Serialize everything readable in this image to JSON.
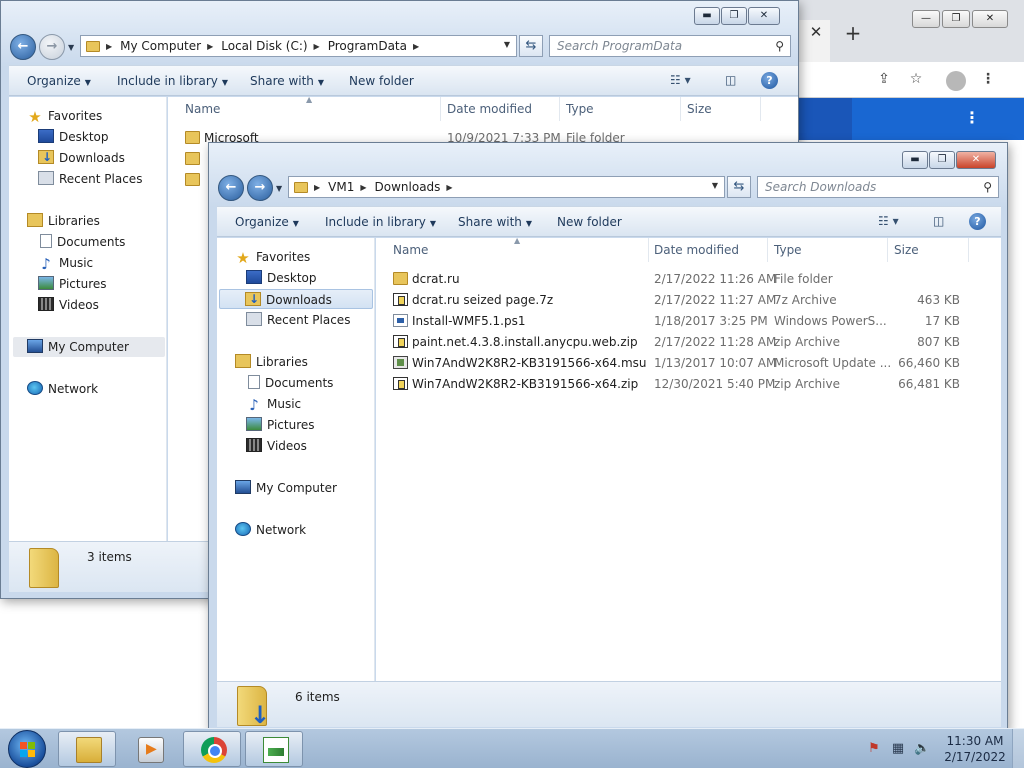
{
  "chrome": {
    "tab_close": "✕",
    "new_tab": "+",
    "window_buttons": [
      "—",
      "❐",
      "✕"
    ],
    "toolbar_icons": [
      "share-icon",
      "star-icon",
      "profile-icon",
      "menu-icon"
    ],
    "menu_glyph": "⋮"
  },
  "explorer_back": {
    "breadcrumb": [
      "My Computer",
      "Local Disk (C:)",
      "ProgramData"
    ],
    "search_placeholder": "Search ProgramData",
    "commands": {
      "organize": "Organize",
      "include_in_library": "Include in library",
      "share_with": "Share with",
      "new_folder": "New folder"
    },
    "columns": [
      "Name",
      "Date modified",
      "Type",
      "Size"
    ],
    "nav": {
      "favorites": "Favorites",
      "desktop": "Desktop",
      "downloads": "Downloads",
      "recent_places": "Recent Places",
      "libraries": "Libraries",
      "documents": "Documents",
      "music": "Music",
      "pictures": "Pictures",
      "videos": "Videos",
      "my_computer": "My Computer",
      "network": "Network"
    },
    "files": [
      {
        "name": "Microsoft",
        "date": "10/9/2021 7:33 PM",
        "type": "File folder",
        "size": ""
      }
    ],
    "item_count": "3 items"
  },
  "explorer_front": {
    "breadcrumb": [
      "VM1",
      "Downloads"
    ],
    "search_placeholder": "Search Downloads",
    "commands": {
      "organize": "Organize",
      "include_in_library": "Include in library",
      "share_with": "Share with",
      "new_folder": "New folder"
    },
    "columns": [
      "Name",
      "Date modified",
      "Type",
      "Size"
    ],
    "nav": {
      "favorites": "Favorites",
      "desktop": "Desktop",
      "downloads": "Downloads",
      "recent_places": "Recent Places",
      "libraries": "Libraries",
      "documents": "Documents",
      "music": "Music",
      "pictures": "Pictures",
      "videos": "Videos",
      "my_computer": "My Computer",
      "network": "Network"
    },
    "files": [
      {
        "name": "dcrat.ru",
        "date": "2/17/2022 11:26 AM",
        "type": "File folder",
        "size": "",
        "icon": "folder-icon"
      },
      {
        "name": "dcrat.ru seized page.7z",
        "date": "2/17/2022 11:27 AM",
        "type": "7z Archive",
        "size": "463 KB",
        "icon": "archive-icon"
      },
      {
        "name": "Install-WMF5.1.ps1",
        "date": "1/18/2017 3:25 PM",
        "type": "Windows PowerS...",
        "size": "17 KB",
        "icon": "powershell-script-icon"
      },
      {
        "name": "paint.net.4.3.8.install.anycpu.web.zip",
        "date": "2/17/2022 11:28 AM",
        "type": "zip Archive",
        "size": "807 KB",
        "icon": "archive-icon"
      },
      {
        "name": "Win7AndW2K8R2-KB3191566-x64.msu",
        "date": "1/13/2017 10:07 AM",
        "type": "Microsoft Update ...",
        "size": "66,460 KB",
        "icon": "update-package-icon"
      },
      {
        "name": "Win7AndW2K8R2-KB3191566-x64.zip",
        "date": "12/30/2021 5:40 PM",
        "type": "zip Archive",
        "size": "66,481 KB",
        "icon": "archive-icon"
      }
    ],
    "item_count": "6 items"
  },
  "window_buttons": {
    "minimize": "▬",
    "maximize": "❐",
    "close": "✕"
  },
  "taskbar": {
    "pinned": [
      "explorer-icon",
      "media-player-icon",
      "chrome-icon",
      "paint-net-icon"
    ],
    "clock_time": "11:30 AM",
    "clock_date": "2/17/2022"
  }
}
